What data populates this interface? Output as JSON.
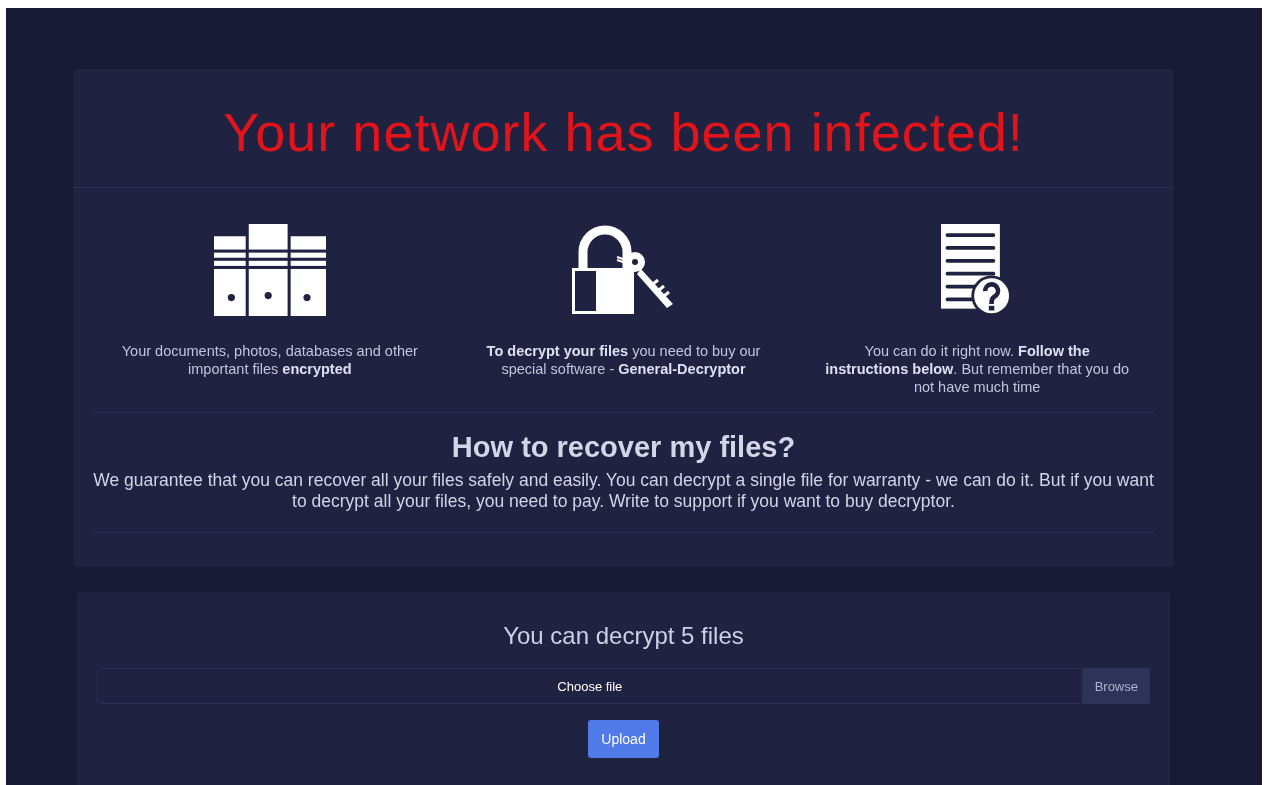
{
  "header": {
    "title": "Your network has been infected!"
  },
  "features": [
    {
      "kind": "servers",
      "text": "Your documents, photos, databases and other important files **encrypted**"
    },
    {
      "kind": "lock",
      "text": "**To decrypt your files** you need to buy our special software - **General-Decryptor**"
    },
    {
      "kind": "document",
      "text": "You can do it right now. **Follow the instructions below**. But remember that you do not have much time"
    }
  ],
  "recover": {
    "heading": "How to recover my files?",
    "text": "We guarantee that you can recover all your files safely and easily. You can decrypt a single file for warranty - we can do it. But if you want to decrypt all your files, you need to pay. Write to support if you want to buy decryptor."
  },
  "decrypt_panel": {
    "title": "You can decrypt 5 files",
    "file_field": {
      "label": "Choose file",
      "button": "Browse"
    },
    "upload_button": "Upload"
  }
}
